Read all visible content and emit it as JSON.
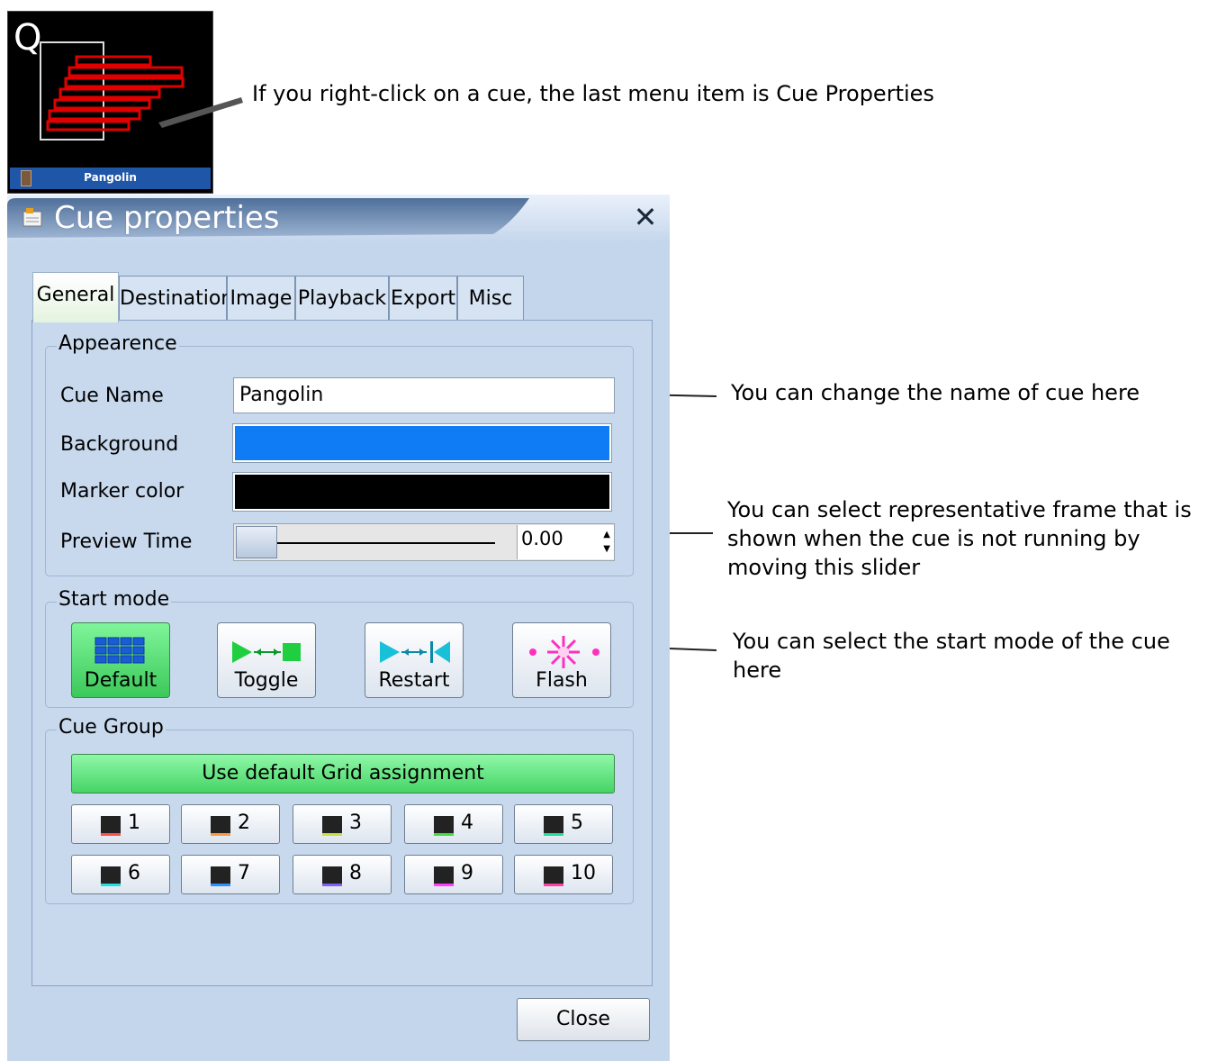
{
  "thumbnail": {
    "name": "Pangolin"
  },
  "annotations": {
    "right_click": "If you right-click on a cue, the last menu item is Cue Properties",
    "change_name": "You can change the name of cue here",
    "frame_line1": "You can select representative frame that is",
    "frame_line2": "shown when the cue is not running by",
    "frame_line3": "moving this slider",
    "start_mode_line1": "You can select the start mode of the cue",
    "start_mode_line2": "here"
  },
  "dialog": {
    "title": "Cue properties",
    "tabs": [
      "General",
      "Destination",
      "Image",
      "Playback",
      "Export",
      "Misc"
    ],
    "active_tab": "General",
    "appearance": {
      "group_title": "Appearence",
      "cue_name_label": "Cue Name",
      "cue_name_value": "Pangolin",
      "background_label": "Background",
      "background_color": "#0f7cf5",
      "marker_label": "Marker color",
      "marker_color": "#000000",
      "preview_label": "Preview Time",
      "preview_value": "0.00"
    },
    "start_mode": {
      "group_title": "Start mode",
      "modes": [
        "Default",
        "Toggle",
        "Restart",
        "Flash"
      ],
      "selected": "Default"
    },
    "cue_group": {
      "group_title": "Cue Group",
      "default_button": "Use default Grid assignment",
      "groups": [
        "1",
        "2",
        "3",
        "4",
        "5",
        "6",
        "7",
        "8",
        "9",
        "10"
      ],
      "group_colors": [
        "#ff5050",
        "#ff9a40",
        "#c8e040",
        "#40e040",
        "#20e0a0",
        "#20e0e0",
        "#3090ff",
        "#8060ff",
        "#ff40ff",
        "#ff40a0"
      ]
    },
    "close_button": "Close"
  }
}
